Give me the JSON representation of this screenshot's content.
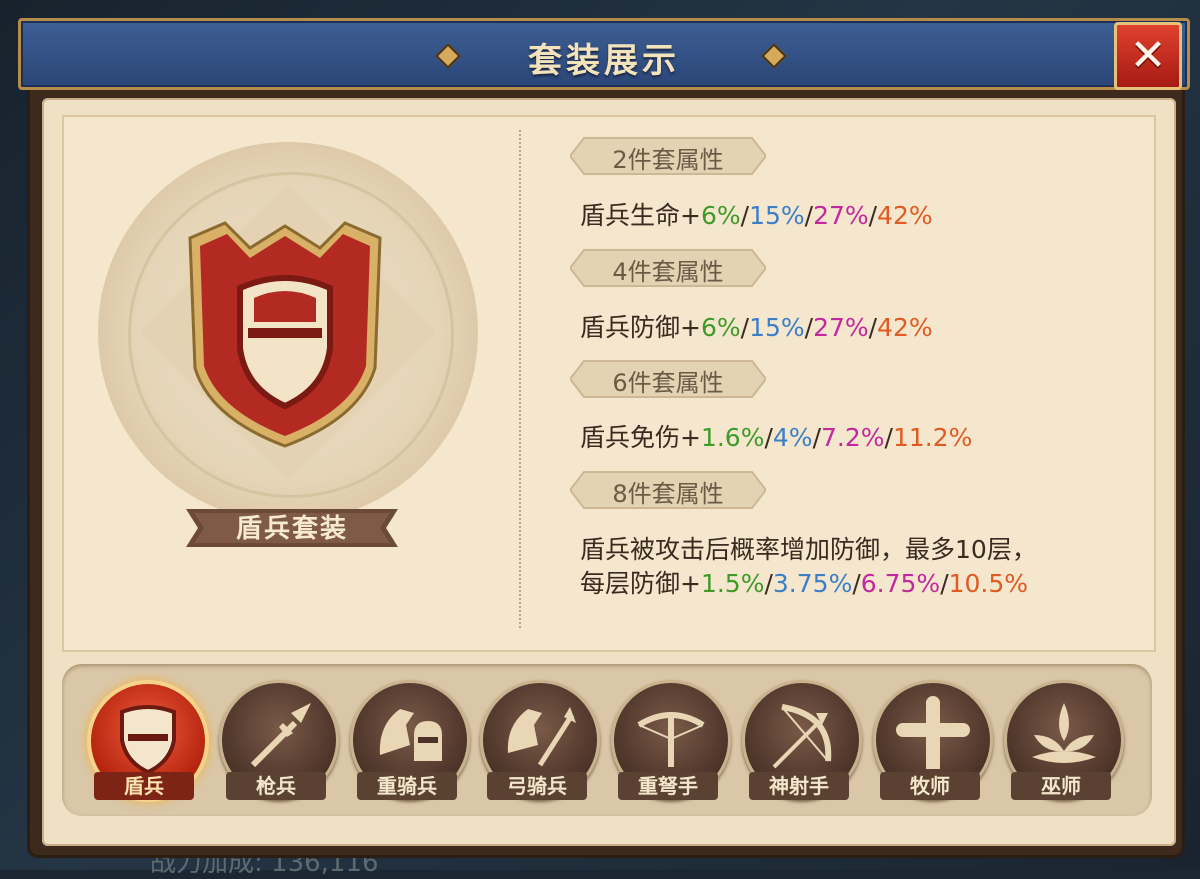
{
  "window": {
    "title": "套装展示",
    "close_label": "✕"
  },
  "background_text": "战力加成: 136,116",
  "set": {
    "name": "盾兵套装",
    "icon": "shield-icon"
  },
  "tiers": [
    {
      "label": "2件套属性",
      "text": "盾兵生命+",
      "values": [
        "6%",
        "15%",
        "27%",
        "42%"
      ]
    },
    {
      "label": "4件套属性",
      "text": "盾兵防御+",
      "values": [
        "6%",
        "15%",
        "27%",
        "42%"
      ]
    },
    {
      "label": "6件套属性",
      "text": "盾兵免伤+",
      "values": [
        "1.6%",
        "4%",
        "7.2%",
        "11.2%"
      ]
    },
    {
      "label": "8件套属性",
      "text_line1": "盾兵被攻击后概率增加防御，最多10层，",
      "text": "每层防御+",
      "values": [
        "1.5%",
        "3.75%",
        "6.75%",
        "10.5%"
      ]
    }
  ],
  "colors": {
    "green": "#3f9a2a",
    "blue": "#3b7fc8",
    "purple": "#c3289e",
    "orange": "#e05a22"
  },
  "tabs": [
    {
      "label": "盾兵",
      "icon": "shield-icon",
      "active": true
    },
    {
      "label": "枪兵",
      "icon": "spear-icon",
      "active": false
    },
    {
      "label": "重骑兵",
      "icon": "knight-helmet-icon",
      "active": false
    },
    {
      "label": "弓骑兵",
      "icon": "horse-archer-icon",
      "active": false
    },
    {
      "label": "重弩手",
      "icon": "crossbow-icon",
      "active": false
    },
    {
      "label": "神射手",
      "icon": "bow-icon",
      "active": false
    },
    {
      "label": "牧师",
      "icon": "holy-cross-icon",
      "active": false
    },
    {
      "label": "巫师",
      "icon": "lotus-magic-icon",
      "active": false
    }
  ]
}
